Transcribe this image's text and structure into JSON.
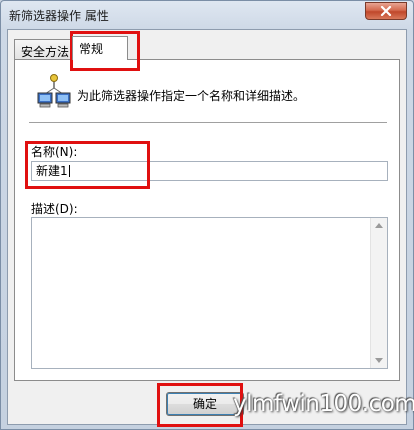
{
  "window": {
    "title": "新筛选器操作 属性"
  },
  "tabs": [
    {
      "label": "安全方法"
    },
    {
      "label": "常规",
      "selected": true
    }
  ],
  "general": {
    "description": "为此筛选器操作指定一个名称和详细描述。",
    "name_label": "名称(N):",
    "name_value": "新建1",
    "desc_label": "描述(D):",
    "desc_value": ""
  },
  "buttons": {
    "ok": "确定"
  },
  "watermark": "ylmfwin100.com",
  "colors": {
    "highlight": "#e01010",
    "close_button": "#c0482b"
  },
  "icons": {
    "header": "network-computers-icon"
  }
}
